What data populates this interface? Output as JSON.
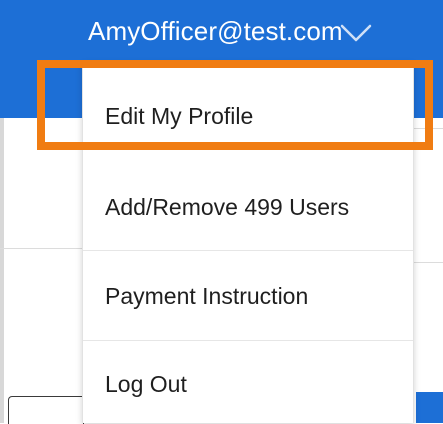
{
  "header": {
    "account_email": "AmyOfficer@test.com",
    "background_color": "#1d6fd6",
    "chevron_icon": "chevron-down-icon"
  },
  "menu": {
    "items": [
      {
        "label": "Edit My Profile"
      },
      {
        "label": "Add/Remove 499 Users"
      },
      {
        "label": "Payment Instruction"
      },
      {
        "label": "Log Out"
      }
    ]
  },
  "highlight": {
    "color": "#f07c12"
  }
}
